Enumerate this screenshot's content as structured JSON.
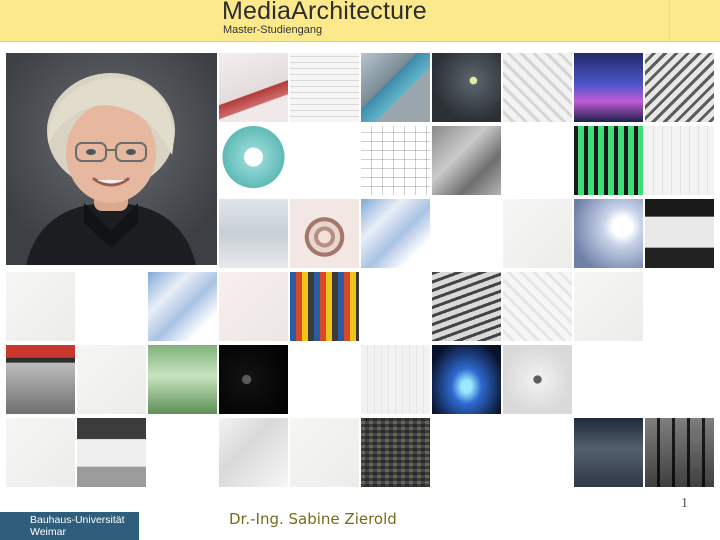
{
  "header": {
    "title": "MediaArchitecture",
    "subtitle": "Master-Studiengang"
  },
  "footer": {
    "university_line1": "Bauhaus-Universität",
    "university_line2": "Weimar",
    "author": "Dr.-Ing. Sabine Zierold",
    "page_number": "1"
  },
  "colors": {
    "header_bg": "#fbe98b",
    "logo_bg": "#2f5e7c",
    "author_text": "#7a6a1a"
  },
  "tiles": [
    {
      "row": 0,
      "col": 3,
      "kind": "interior-red"
    },
    {
      "row": 0,
      "col": 4,
      "kind": "grid-facade"
    },
    {
      "row": 0,
      "col": 5,
      "kind": "screen-cube"
    },
    {
      "row": 0,
      "col": 6,
      "kind": "network-dark"
    },
    {
      "row": 0,
      "col": 7,
      "kind": "white-cubes"
    },
    {
      "row": 0,
      "col": 8,
      "kind": "blue-lights"
    },
    {
      "row": 0,
      "col": 9,
      "kind": "zigzag"
    },
    {
      "row": 1,
      "col": 3,
      "kind": "teal-block"
    },
    {
      "row": 1,
      "col": 4,
      "kind": "blank"
    },
    {
      "row": 1,
      "col": 5,
      "kind": "wire-grid"
    },
    {
      "row": 1,
      "col": 6,
      "kind": "gray-collage"
    },
    {
      "row": 1,
      "col": 7,
      "kind": "blank"
    },
    {
      "row": 1,
      "col": 8,
      "kind": "green-bars"
    },
    {
      "row": 1,
      "col": 9,
      "kind": "light-lines"
    },
    {
      "row": 2,
      "col": 3,
      "kind": "faded-rooms"
    },
    {
      "row": 2,
      "col": 4,
      "kind": "spiral-stairs"
    },
    {
      "row": 2,
      "col": 5,
      "kind": "crystal-blue"
    },
    {
      "row": 2,
      "col": 6,
      "kind": "blank"
    },
    {
      "row": 2,
      "col": 7,
      "kind": "faint"
    },
    {
      "row": 2,
      "col": 8,
      "kind": "people-light"
    },
    {
      "row": 2,
      "col": 9,
      "kind": "tent-dark"
    },
    {
      "row": 3,
      "col": 0,
      "kind": "faint"
    },
    {
      "row": 3,
      "col": 1,
      "kind": "blank"
    },
    {
      "row": 3,
      "col": 2,
      "kind": "crystal-blue"
    },
    {
      "row": 3,
      "col": 3,
      "kind": "faint-pink"
    },
    {
      "row": 3,
      "col": 4,
      "kind": "colored-facade"
    },
    {
      "row": 3,
      "col": 5,
      "kind": "blank"
    },
    {
      "row": 3,
      "col": 6,
      "kind": "stripes"
    },
    {
      "row": 3,
      "col": 7,
      "kind": "white-cubes-faded"
    },
    {
      "row": 3,
      "col": 8,
      "kind": "faint"
    },
    {
      "row": 3,
      "col": 9,
      "kind": "blank"
    },
    {
      "row": 4,
      "col": 0,
      "kind": "map-red"
    },
    {
      "row": 4,
      "col": 1,
      "kind": "faint"
    },
    {
      "row": 4,
      "col": 2,
      "kind": "green-room"
    },
    {
      "row": 4,
      "col": 3,
      "kind": "map-dark"
    },
    {
      "row": 4,
      "col": 4,
      "kind": "blank"
    },
    {
      "row": 4,
      "col": 5,
      "kind": "faint-lines"
    },
    {
      "row": 4,
      "col": 6,
      "kind": "glow-blue"
    },
    {
      "row": 4,
      "col": 7,
      "kind": "figure-sketch"
    },
    {
      "row": 4,
      "col": 8,
      "kind": "blank"
    },
    {
      "row": 4,
      "col": 9,
      "kind": "blank"
    },
    {
      "row": 5,
      "col": 0,
      "kind": "faint"
    },
    {
      "row": 5,
      "col": 1,
      "kind": "white-interior"
    },
    {
      "row": 5,
      "col": 2,
      "kind": "blank"
    },
    {
      "row": 5,
      "col": 3,
      "kind": "model-faded"
    },
    {
      "row": 5,
      "col": 4,
      "kind": "faint"
    },
    {
      "row": 5,
      "col": 5,
      "kind": "pixel-noise"
    },
    {
      "row": 5,
      "col": 6,
      "kind": "blank"
    },
    {
      "row": 5,
      "col": 7,
      "kind": "blank"
    },
    {
      "row": 5,
      "col": 8,
      "kind": "dark-screen"
    },
    {
      "row": 5,
      "col": 9,
      "kind": "window-figure"
    }
  ]
}
